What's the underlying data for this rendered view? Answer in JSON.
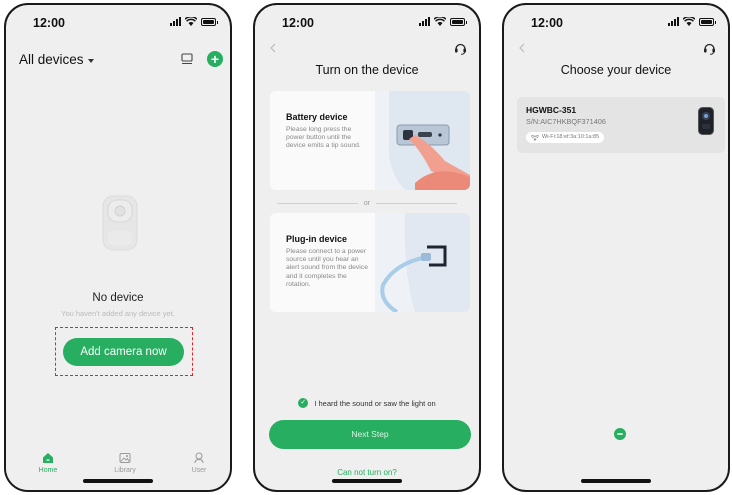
{
  "status_bar": {
    "time": "12:00"
  },
  "colors": {
    "brand_green": "#27ae60",
    "highlight_red": "#e0262a",
    "background": "#efefef"
  },
  "screen1": {
    "header": {
      "title": "All devices",
      "icons": [
        "device-list-icon",
        "add-device-icon"
      ]
    },
    "empty_state": {
      "title": "No device",
      "subtitle": "You haven't added any device yet.",
      "button": "Add camera now"
    },
    "tabs": [
      {
        "label": "Home",
        "icon": "home-icon",
        "active": true
      },
      {
        "label": "Library",
        "icon": "library-icon",
        "active": false
      },
      {
        "label": "User",
        "icon": "user-icon",
        "active": false
      }
    ]
  },
  "screen2": {
    "title": "Turn on the device",
    "battery": {
      "title": "Battery device",
      "description": "Please long press the power button until the device emits a tip sound."
    },
    "divider": "or",
    "plugin": {
      "title": "Plug-in device",
      "description": "Please connect to a power source until you hear an alert sound from the device and it completes the rotation."
    },
    "confirm_label": "I heard the sound or saw the light on",
    "next_button": "Next Step",
    "help_link": "Can not turn on?"
  },
  "screen3": {
    "title": "Choose your device",
    "device": {
      "name": "HGWBC-351",
      "serial": "S/N:AIC7HKBQF371406",
      "wifi": "Wi-Fi:18:ef:3a:10:1a:85"
    }
  }
}
